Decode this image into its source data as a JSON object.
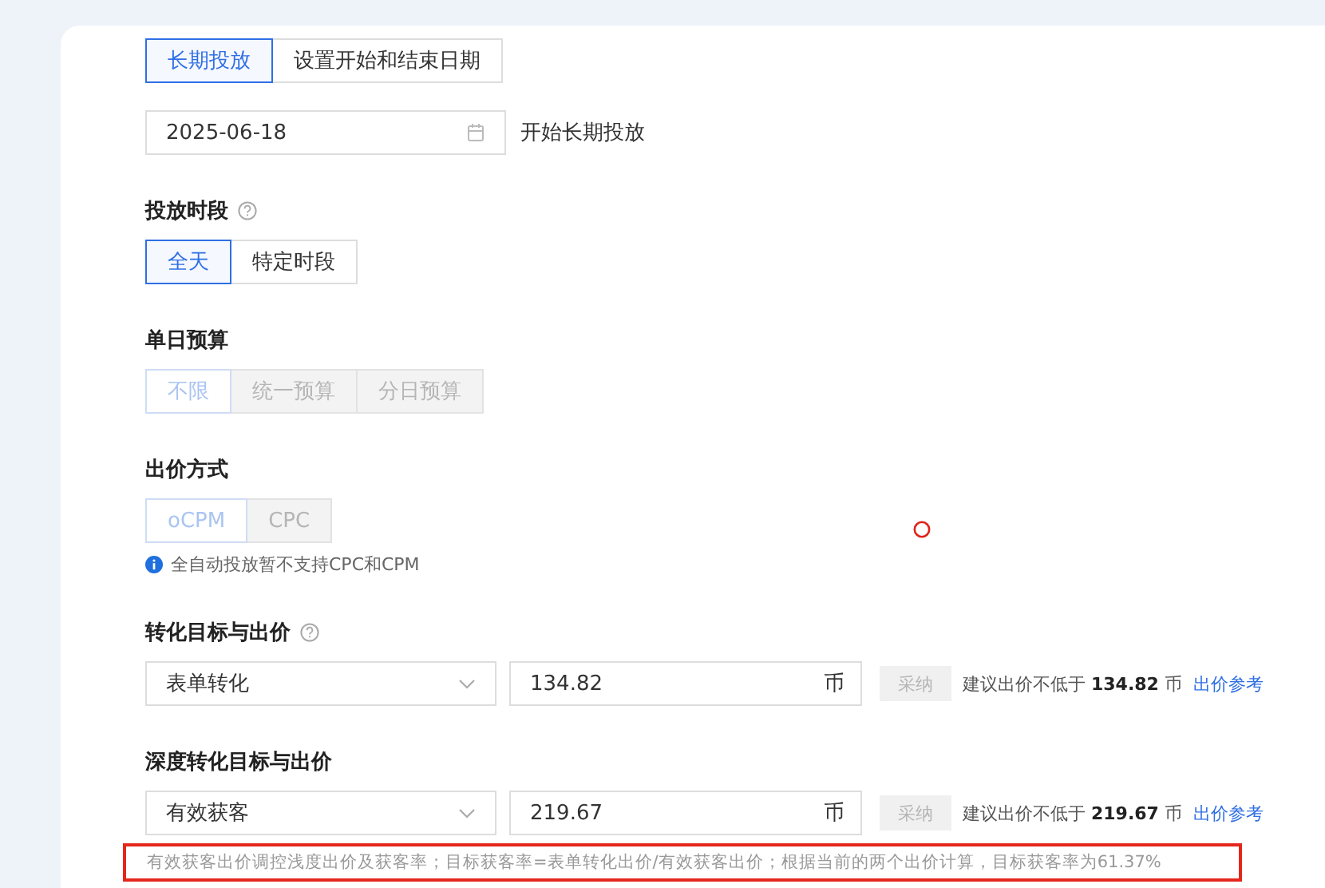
{
  "delivery_mode": {
    "options": [
      {
        "label": "长期投放",
        "selected": true,
        "disabled": false
      },
      {
        "label": "设置开始和结束日期",
        "selected": false,
        "disabled": false
      }
    ]
  },
  "start_date": {
    "value": "2025-06-18",
    "suffix": "开始长期投放"
  },
  "sections": [
    {
      "kind": "segmented",
      "label": "投放时段",
      "help": true,
      "options": [
        {
          "label": "全天",
          "selected": true,
          "disabled": false
        },
        {
          "label": "特定时段",
          "selected": false,
          "disabled": false
        }
      ]
    },
    {
      "kind": "segmented",
      "label": "单日预算",
      "help": false,
      "options": [
        {
          "label": "不限",
          "selected": true,
          "disabled": true
        },
        {
          "label": "统一预算",
          "selected": false,
          "disabled": true
        },
        {
          "label": "分日预算",
          "selected": false,
          "disabled": true
        }
      ]
    },
    {
      "kind": "segmented",
      "label": "出价方式",
      "help": false,
      "options": [
        {
          "label": "oCPM",
          "selected": true,
          "disabled": true
        },
        {
          "label": "CPC",
          "selected": false,
          "disabled": true
        }
      ],
      "info": "全自动投放暂不支持CPC和CPM"
    },
    {
      "kind": "bid",
      "label": "转化目标与出价",
      "help": true,
      "goal": "表单转化",
      "price": "134.82",
      "unit": "币",
      "adopt": {
        "label": "采纳",
        "disabled": true
      },
      "suggestion": "建议出价不低于 **134.82** 币",
      "link": "出价参考"
    },
    {
      "kind": "bid",
      "label": "深度转化目标与出价",
      "help": false,
      "goal": "有效获客",
      "price": "219.67",
      "unit": "币",
      "adopt": {
        "label": "采纳",
        "disabled": true
      },
      "suggestion": "建议出价不低于 **219.67** 币",
      "link": "出价参考"
    }
  ],
  "note": {
    "text": "有效获客出价调控浅度出价及获客率；目标获客率=表单转化出价/有效获客出价；根据当前的两个出价计算，目标获客率为61.37%",
    "highlighted": true
  },
  "marker": {
    "kind": "circle"
  }
}
